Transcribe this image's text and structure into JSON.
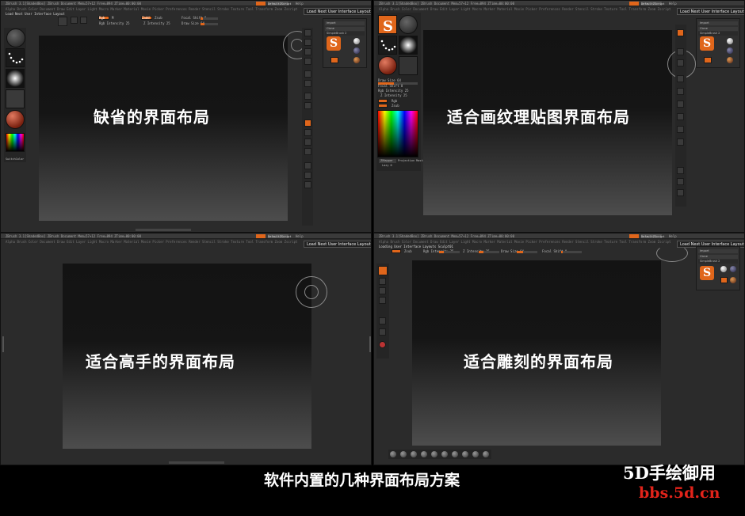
{
  "panels": {
    "default": {
      "caption": "缺省的界面布局",
      "layout_button": "Load Next User Interface Layout"
    },
    "texture": {
      "caption": "适合画纹理贴图界面布局",
      "layout_button": "Load Next User Interface Layout"
    },
    "expert": {
      "caption": "适合高手的界面布局",
      "layout_button": "Load Next User Interface Layout"
    },
    "sculpt": {
      "caption": "适合雕刻的界面布局",
      "layout_button": "Load Next User Interface Layout",
      "loading_text": "Loading User Interface Layouts Sculpt01"
    }
  },
  "common": {
    "menubar_title": "ZBrush 3.1[ShadedBox]  ZBrush Document   Mem=57+12  Free=894  ZTime=00:00:00",
    "menubar_script": "DefaultZScript",
    "menubar_help": "Help",
    "menus": "Alpha Brush Color Document Draw Edit Layer Light Macro Marker Material Movie Picker Preferences Render Stencil Stroke Texture Tool Transform Zoom Zscript",
    "palette_import": "Import",
    "palette_clone": "Clone",
    "palette_simplebrush": "SimpleBrush 2",
    "palette_eraser": "EraserBrush",
    "zadd": "Zadd",
    "zsub": "Zsub",
    "rgb": "Rgb",
    "m": "M",
    "rgb_intensity": "Rgb Intensity 25",
    "z_intensity": "Z Intensity 25",
    "focal_shift": "Focal Shift 0",
    "draw_size": "Draw Size 64",
    "zmapper": "ZMapper",
    "projection_master": "Projection Master",
    "lazy": "Lazy 0"
  },
  "colors": {
    "accent": "#e0661b",
    "panel_bg": "#2b2b2b",
    "watermark_red": "#e2231a"
  },
  "footer": {
    "caption": "软件内置的几种界面布局方案",
    "watermark": "5D手绘御用",
    "watermark_url": "bbs.5d.cn"
  }
}
